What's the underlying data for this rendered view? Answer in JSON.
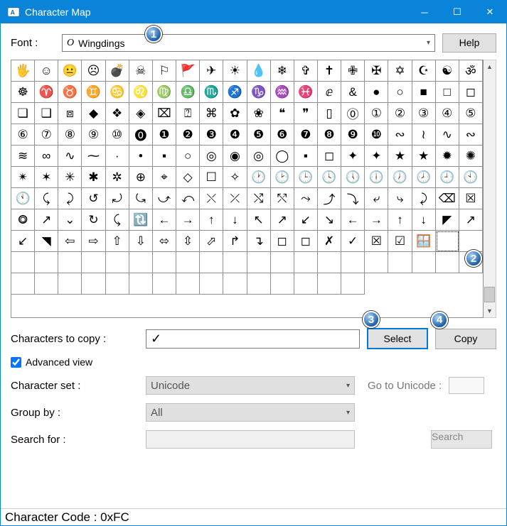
{
  "title": "Character Map",
  "font_label": "Font :",
  "font_value": "Wingdings",
  "help_label": "Help",
  "grid": [
    "🖐",
    "☺",
    "😐",
    "☹",
    "💣",
    "☠",
    "⚐",
    "🚩",
    "✈",
    "☀",
    "💧",
    "❄",
    "✞",
    "✝",
    "✙",
    "✠",
    "✡",
    "☪",
    "☯",
    "ॐ",
    "☸",
    "♈",
    "♉",
    "♊",
    "♋",
    "♌",
    "♍",
    "♎",
    "♏",
    "♐",
    "♑",
    "♒",
    "♓",
    "ⅇ",
    "&",
    "●",
    "○",
    "■",
    "□",
    "◻",
    "❏",
    "❑",
    "⧈",
    "◆",
    "❖",
    "◈",
    "⌧",
    "⍰",
    "⌘",
    "✿",
    "❀",
    "❝",
    "❞",
    "▯",
    "⓪",
    "①",
    "②",
    "③",
    "④",
    "⑤",
    "⑥",
    "⑦",
    "⑧",
    "⑨",
    "⑩",
    "⓿",
    "❶",
    "❷",
    "❸",
    "❹",
    "❺",
    "❻",
    "❼",
    "❽",
    "❾",
    "❿",
    "∾",
    "≀",
    "∿",
    "∾",
    "≋",
    "∞",
    "∿",
    "⁓",
    "·",
    "•",
    "▪",
    "○",
    "◎",
    "◉",
    "◎",
    "◯",
    "▪",
    "◻",
    "✦",
    "✦",
    "★",
    "★",
    "✹",
    "✺",
    "✴",
    "✶",
    "✳",
    "✱",
    "✲",
    "⊕",
    "⌖",
    "◇",
    "☐",
    "✧",
    "🕐",
    "🕑",
    "🕒",
    "🕓",
    "🕔",
    "🕕",
    "🕖",
    "🕗",
    "🕘",
    "🕙",
    "🕚",
    "⤹",
    "⤸",
    "↺",
    "⤾",
    "⤿",
    "⤻",
    "⤺",
    "⤬",
    "⤫",
    "⤭",
    "⤲",
    "⤳",
    "⤴",
    "⤵",
    "⤶",
    "⤷",
    "⤸",
    "⌫",
    "☒",
    "⭗",
    "↗",
    "⌄",
    "↻",
    "⤹",
    "🔃",
    "←",
    "→",
    "↑",
    "↓",
    "↖",
    "↗",
    "↙",
    "↘",
    "←",
    "→",
    "↑",
    "↓",
    "◤",
    "↗",
    "↙",
    "◥",
    "⇦",
    "⇨",
    "⇧",
    "⇩",
    "⬄",
    "⇳",
    "⬀",
    "↱",
    "↴",
    "◻",
    "◻",
    "✗",
    "✓",
    "☒",
    "☑",
    "🪟",
    "",
    "",
    "",
    "",
    "",
    "",
    "",
    "",
    "",
    "",
    "",
    "",
    "",
    "",
    "",
    "",
    "",
    "",
    "",
    "",
    "",
    "",
    "",
    "",
    "",
    "",
    "",
    "",
    "",
    "",
    "",
    "",
    "",
    "",
    "",
    "",
    ""
  ],
  "selected_cell_index": 178,
  "copy_label": "Characters to copy :",
  "copy_value": "✓",
  "select_label": "Select",
  "copy_btn_label": "Copy",
  "advanced_checked": true,
  "advanced_label": "Advanced view",
  "charset_label": "Character set :",
  "charset_value": "Unicode",
  "goto_label": "Go to Unicode :",
  "groupby_label": "Group by :",
  "groupby_value": "All",
  "search_label": "Search for :",
  "search_btn_label": "Search",
  "status": "Character Code : 0xFC",
  "badges": {
    "1": "1",
    "2": "2",
    "3": "3",
    "4": "4"
  }
}
